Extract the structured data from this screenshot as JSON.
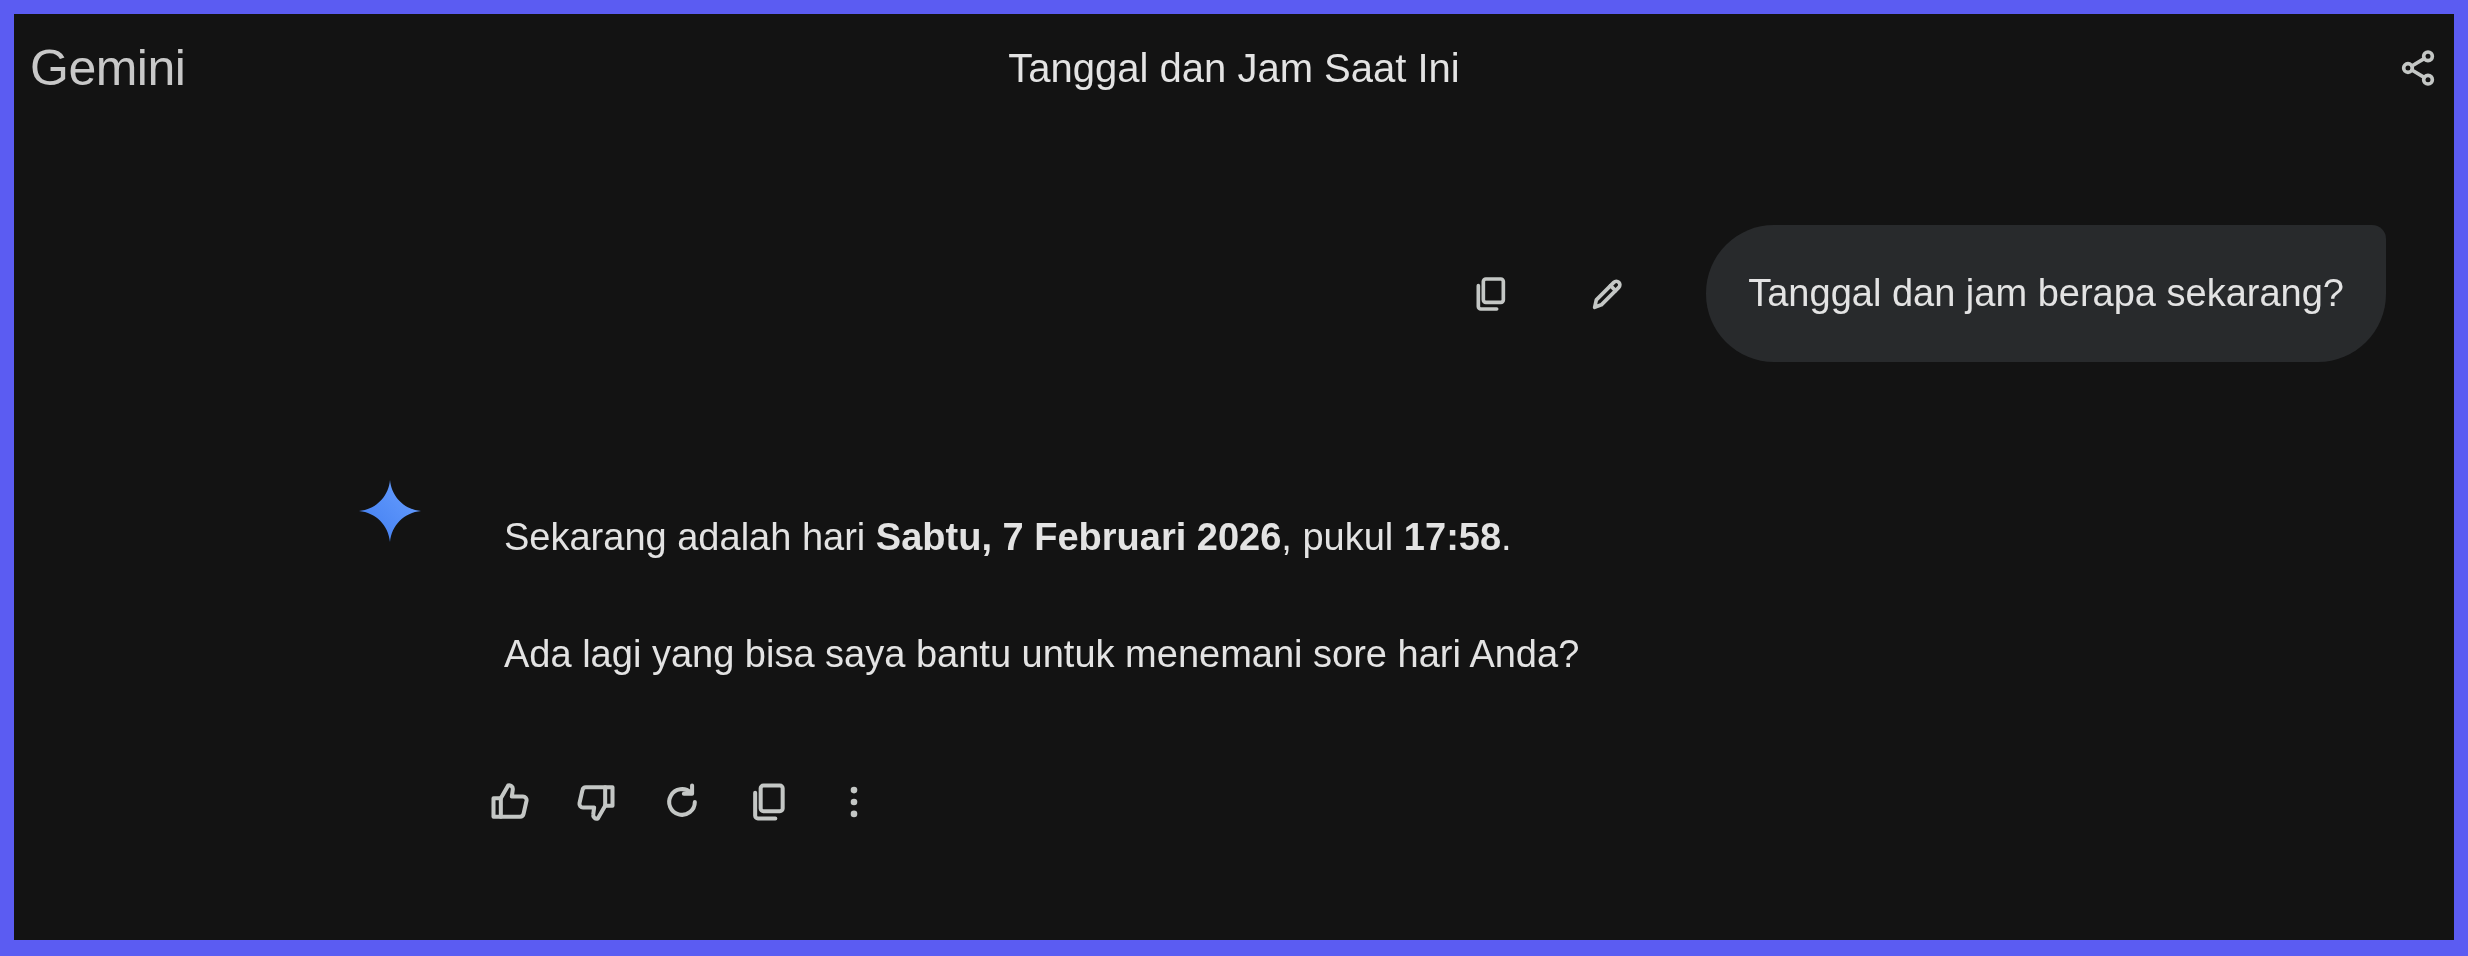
{
  "header": {
    "logo": "Gemini",
    "title": "Tanggal dan Jam Saat Ini"
  },
  "user_message": {
    "text": "Tanggal dan jam berapa sekarang?"
  },
  "response": {
    "paragraphs": [
      "Sekarang adalah hari **Sabtu, 7 Februari 2026**, pukul **17:58**.",
      "Ada lagi yang bisa saya bantu untuk menemani sore hari Anda?"
    ]
  }
}
